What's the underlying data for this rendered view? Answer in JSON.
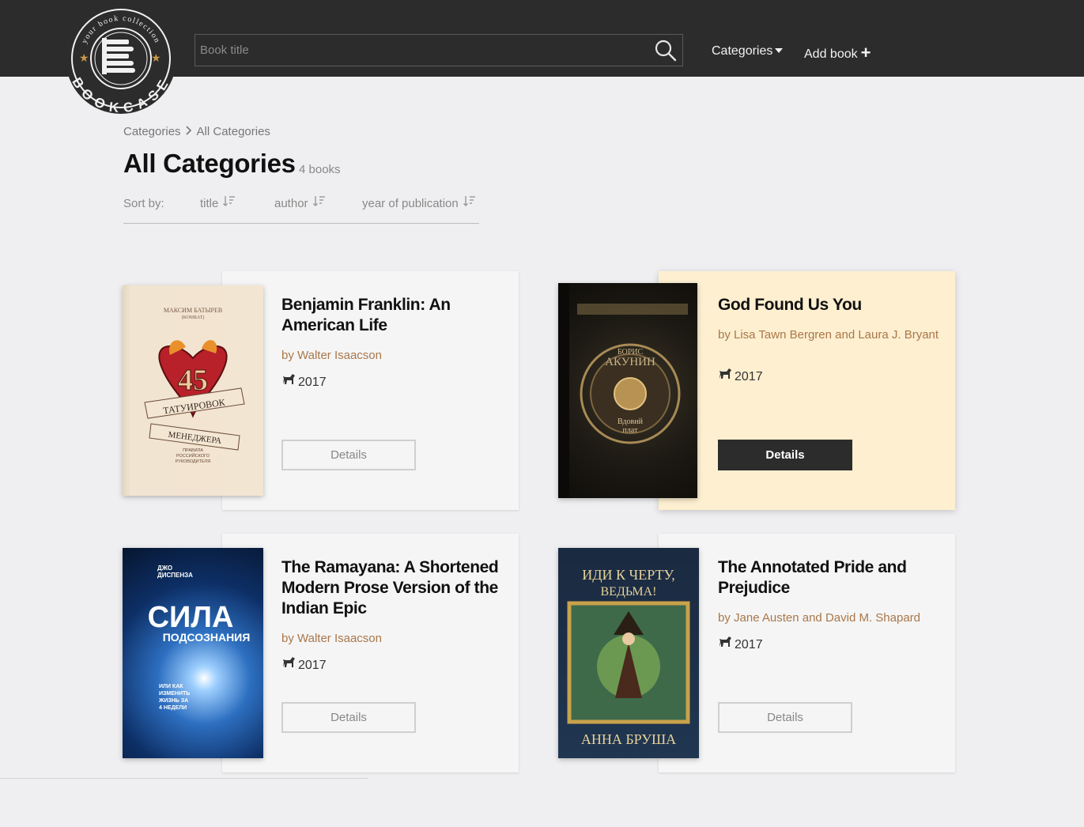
{
  "logo": {
    "top_text": "your book collection",
    "bottom_text": "BOOKCASE"
  },
  "search": {
    "placeholder": "Book title",
    "value": ""
  },
  "nav": {
    "categories": "Categories",
    "add_book": "Add book"
  },
  "breadcrumb": [
    "Categories",
    "All Categories"
  ],
  "page": {
    "title": "All Categories",
    "count": "4 books"
  },
  "sort": {
    "label": "Sort by:",
    "options": [
      "title",
      "author",
      "year of publication"
    ]
  },
  "books": [
    {
      "title": "Benjamin Franklin: An American Life",
      "author": "by Walter Isaacson",
      "year": "2017",
      "button": "Details",
      "cover_text": [
        "МАКСИМ БАТЫРЕВ",
        "(КОМБАТ)",
        "45",
        "ТАТУИРОВОК",
        "МЕНЕДЖЕРА",
        "ПРАВИЛА",
        "РОССИЙСКОГО",
        "РУКОВОДИТЕЛЯ"
      ]
    },
    {
      "title": "God Found Us You",
      "author": "by Lisa Tawn Bergren and Laura J. Bryant",
      "year": "2017",
      "button": "Details",
      "cover_text": [
        "БОРИС",
        "АКУНИН",
        "Вдовий",
        "плат"
      ]
    },
    {
      "title": "The Ramayana: A Shortened Modern Prose Version of the Indian Epic",
      "author": "by Walter Isaacson",
      "year": "2017",
      "button": "Details",
      "cover_text": [
        "ДЖО",
        "ДИСПЕНЗА",
        "СИЛА",
        "ПОДСОЗНАНИЯ",
        "ИЛИ КАК",
        "ИЗМЕНИТЬ",
        "ЖИЗНЬ ЗА",
        "4 НЕДЕЛИ"
      ]
    },
    {
      "title": "The Annotated Pride and Prejudice",
      "author": "by Jane Austen and David M. Shapard",
      "year": "2017",
      "button": "Details",
      "cover_text": [
        "ИДИ К ЧЕРТУ,",
        "ВЕДЬМА!",
        "АННА БРУША"
      ]
    }
  ],
  "colors": {
    "header": "#2c2c2c",
    "author": "#a9774a",
    "highlight_card": "#fdefd0",
    "background": "#efeff1"
  }
}
